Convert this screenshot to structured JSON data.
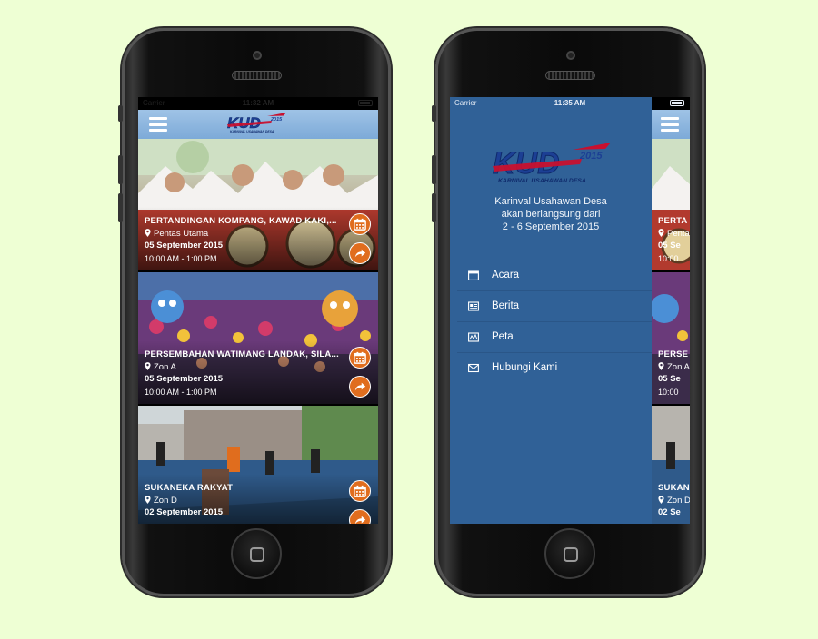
{
  "colors": {
    "background": "#eeffd4",
    "drawer": "#306197",
    "accent_button": "#e06d1e",
    "appbar": "#8fb7e0"
  },
  "brand": {
    "logo_text": "KUD",
    "logo_year": "2015",
    "logo_sub": "KARNIVAL USAHAWAN DESA"
  },
  "left_phone": {
    "status": {
      "carrier": "Carrier",
      "time": "11:32 AM"
    },
    "events": [
      {
        "title": "PERTANDINGAN KOMPANG, KAWAD KAKI,...",
        "location": "Pentas Utama",
        "date": "05 September 2015",
        "time": "10:00 AM - 1:00 PM"
      },
      {
        "title": "PERSEMBAHAN WATIMANG LANDAK, SILA...",
        "location": "Zon A",
        "date": "05 September 2015",
        "time": "10:00 AM - 1:00 PM"
      },
      {
        "title": "SUKANEKA RAKYAT",
        "location": "Zon D",
        "date": "02 September 2015",
        "time": ""
      }
    ]
  },
  "right_phone": {
    "status": {
      "carrier": "Carrier",
      "time": "11:35 AM"
    },
    "tagline": [
      "Karinval Usahawan Desa",
      "akan berlangsung dari",
      "2 - 6 September 2015"
    ],
    "menu": [
      {
        "label": "Acara",
        "icon": "calendar-icon"
      },
      {
        "label": "Berita",
        "icon": "newspaper-icon"
      },
      {
        "label": "Peta",
        "icon": "map-icon"
      },
      {
        "label": "Hubungi Kami",
        "icon": "envelope-icon"
      }
    ],
    "peek": [
      {
        "title": "PERTA",
        "location": "Penta",
        "date": "05 Se",
        "time": "10:00"
      },
      {
        "title": "PERSE",
        "location": "Zon A",
        "date": "05 Se",
        "time": "10:00"
      },
      {
        "title": "SUKAN",
        "location": "Zon D",
        "date": "02 Se",
        "time": ""
      }
    ]
  }
}
